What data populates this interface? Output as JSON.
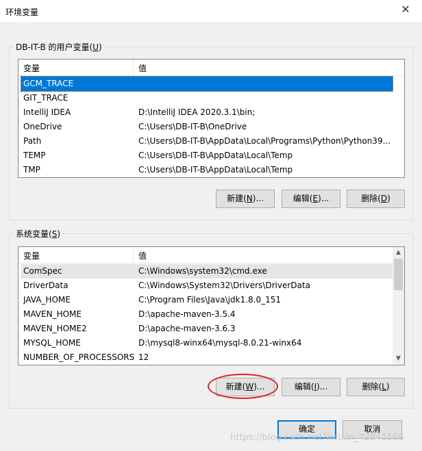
{
  "window": {
    "title": "环境变量",
    "close_glyph": "✕"
  },
  "user_vars": {
    "group_label_pre": "DB-IT-B 的用户变量(",
    "group_label_key": "U",
    "group_label_post": ")",
    "col_var": "变量",
    "col_val": "值",
    "rows": [
      {
        "name": "GCM_TRACE",
        "value": "",
        "selected": true
      },
      {
        "name": "GIT_TRACE",
        "value": ""
      },
      {
        "name": "IntelliJ IDEA",
        "value": "D:\\IntelliJ IDEA 2020.3.1\\bin;"
      },
      {
        "name": "OneDrive",
        "value": "C:\\Users\\DB-IT-B\\OneDrive"
      },
      {
        "name": "Path",
        "value": "C:\\Users\\DB-IT-B\\AppData\\Local\\Programs\\Python\\Python39..."
      },
      {
        "name": "TEMP",
        "value": "C:\\Users\\DB-IT-B\\AppData\\Local\\Temp"
      },
      {
        "name": "TMP",
        "value": "C:\\Users\\DB-IT-B\\AppData\\Local\\Temp"
      }
    ],
    "buttons": {
      "new_pre": "新建(",
      "new_key": "N",
      "new_post": ")...",
      "edit_pre": "编辑(",
      "edit_key": "E",
      "edit_post": ")...",
      "delete_pre": "删除(",
      "delete_key": "D",
      "delete_post": ")"
    }
  },
  "system_vars": {
    "group_label_pre": "系统变量(",
    "group_label_key": "S",
    "group_label_post": ")",
    "col_var": "变量",
    "col_val": "值",
    "rows": [
      {
        "name": "ComSpec",
        "value": "C:\\Windows\\system32\\cmd.exe",
        "hover": true
      },
      {
        "name": "DriverData",
        "value": "C:\\Windows\\System32\\Drivers\\DriverData"
      },
      {
        "name": "JAVA_HOME",
        "value": "C:\\Program Files\\Java\\jdk1.8.0_151"
      },
      {
        "name": "MAVEN_HOME",
        "value": "D:\\apache-maven-3.5.4"
      },
      {
        "name": "MAVEN_HOME2",
        "value": "D:\\apache-maven-3.6.3"
      },
      {
        "name": "MYSQL_HOME",
        "value": "D:\\mysql8-winx64\\mysql-8.0.21-winx64"
      },
      {
        "name": "NUMBER_OF_PROCESSORS",
        "value": "12"
      }
    ],
    "scroll_up_glyph": "▲",
    "scroll_down_glyph": "▼",
    "buttons": {
      "new_pre": "新建(",
      "new_key": "W",
      "new_post": ")...",
      "edit_pre": "编辑(",
      "edit_key": "I",
      "edit_post": ")...",
      "delete_pre": "删除(",
      "delete_key": "L",
      "delete_post": ")"
    }
  },
  "footer": {
    "ok_label": "确定",
    "cancel_label": "取消"
  },
  "annotation": {
    "color": "#e0201b"
  },
  "watermark": "https://blog.csdn.net/weixin_42841566",
  "colors": {
    "selection": "#0078d7",
    "dialog_bg": "#f0f0f0"
  }
}
